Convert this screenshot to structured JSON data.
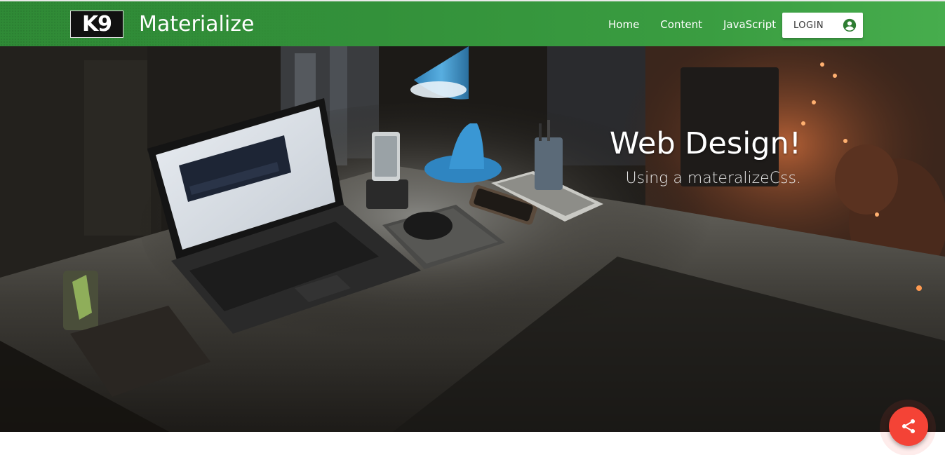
{
  "navbar": {
    "logo_text": "K9",
    "brand": "Materialize",
    "links": [
      {
        "label": "Home"
      },
      {
        "label": "Content"
      },
      {
        "label": "JavaScript"
      }
    ],
    "login_label": "LOGIN",
    "login_icon": "account-circle-icon"
  },
  "hero": {
    "title": "Web Design!",
    "subtitle": "Using a materalizeCss."
  },
  "fab": {
    "icon": "share-icon",
    "color": "#f44336"
  },
  "colors": {
    "navbar": "#388e3c",
    "accent": "#f44336"
  }
}
